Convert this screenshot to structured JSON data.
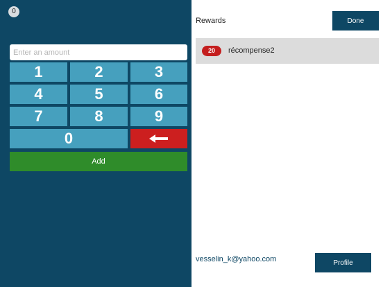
{
  "counter": {
    "value": "0"
  },
  "amount_input": {
    "placeholder": "Enter an amount",
    "value": ""
  },
  "keypad": {
    "k1": "1",
    "k2": "2",
    "k3": "3",
    "k4": "4",
    "k5": "5",
    "k6": "6",
    "k7": "7",
    "k8": "8",
    "k9": "9",
    "k0": "0",
    "backspace_icon": "left-arrow-icon"
  },
  "add_button": {
    "label": "Add"
  },
  "rewards": {
    "title": "Rewards",
    "done_label": "Done",
    "items": [
      {
        "points": "20",
        "name": "récompense2"
      }
    ]
  },
  "account": {
    "email": "vesselin_k@yahoo.com",
    "profile_label": "Profile"
  },
  "colors": {
    "panel": "#0e4764",
    "key": "#46a0be",
    "backspace": "#cc1f1f",
    "add": "#2f8c2a",
    "reward_row": "#dcdcdc"
  }
}
